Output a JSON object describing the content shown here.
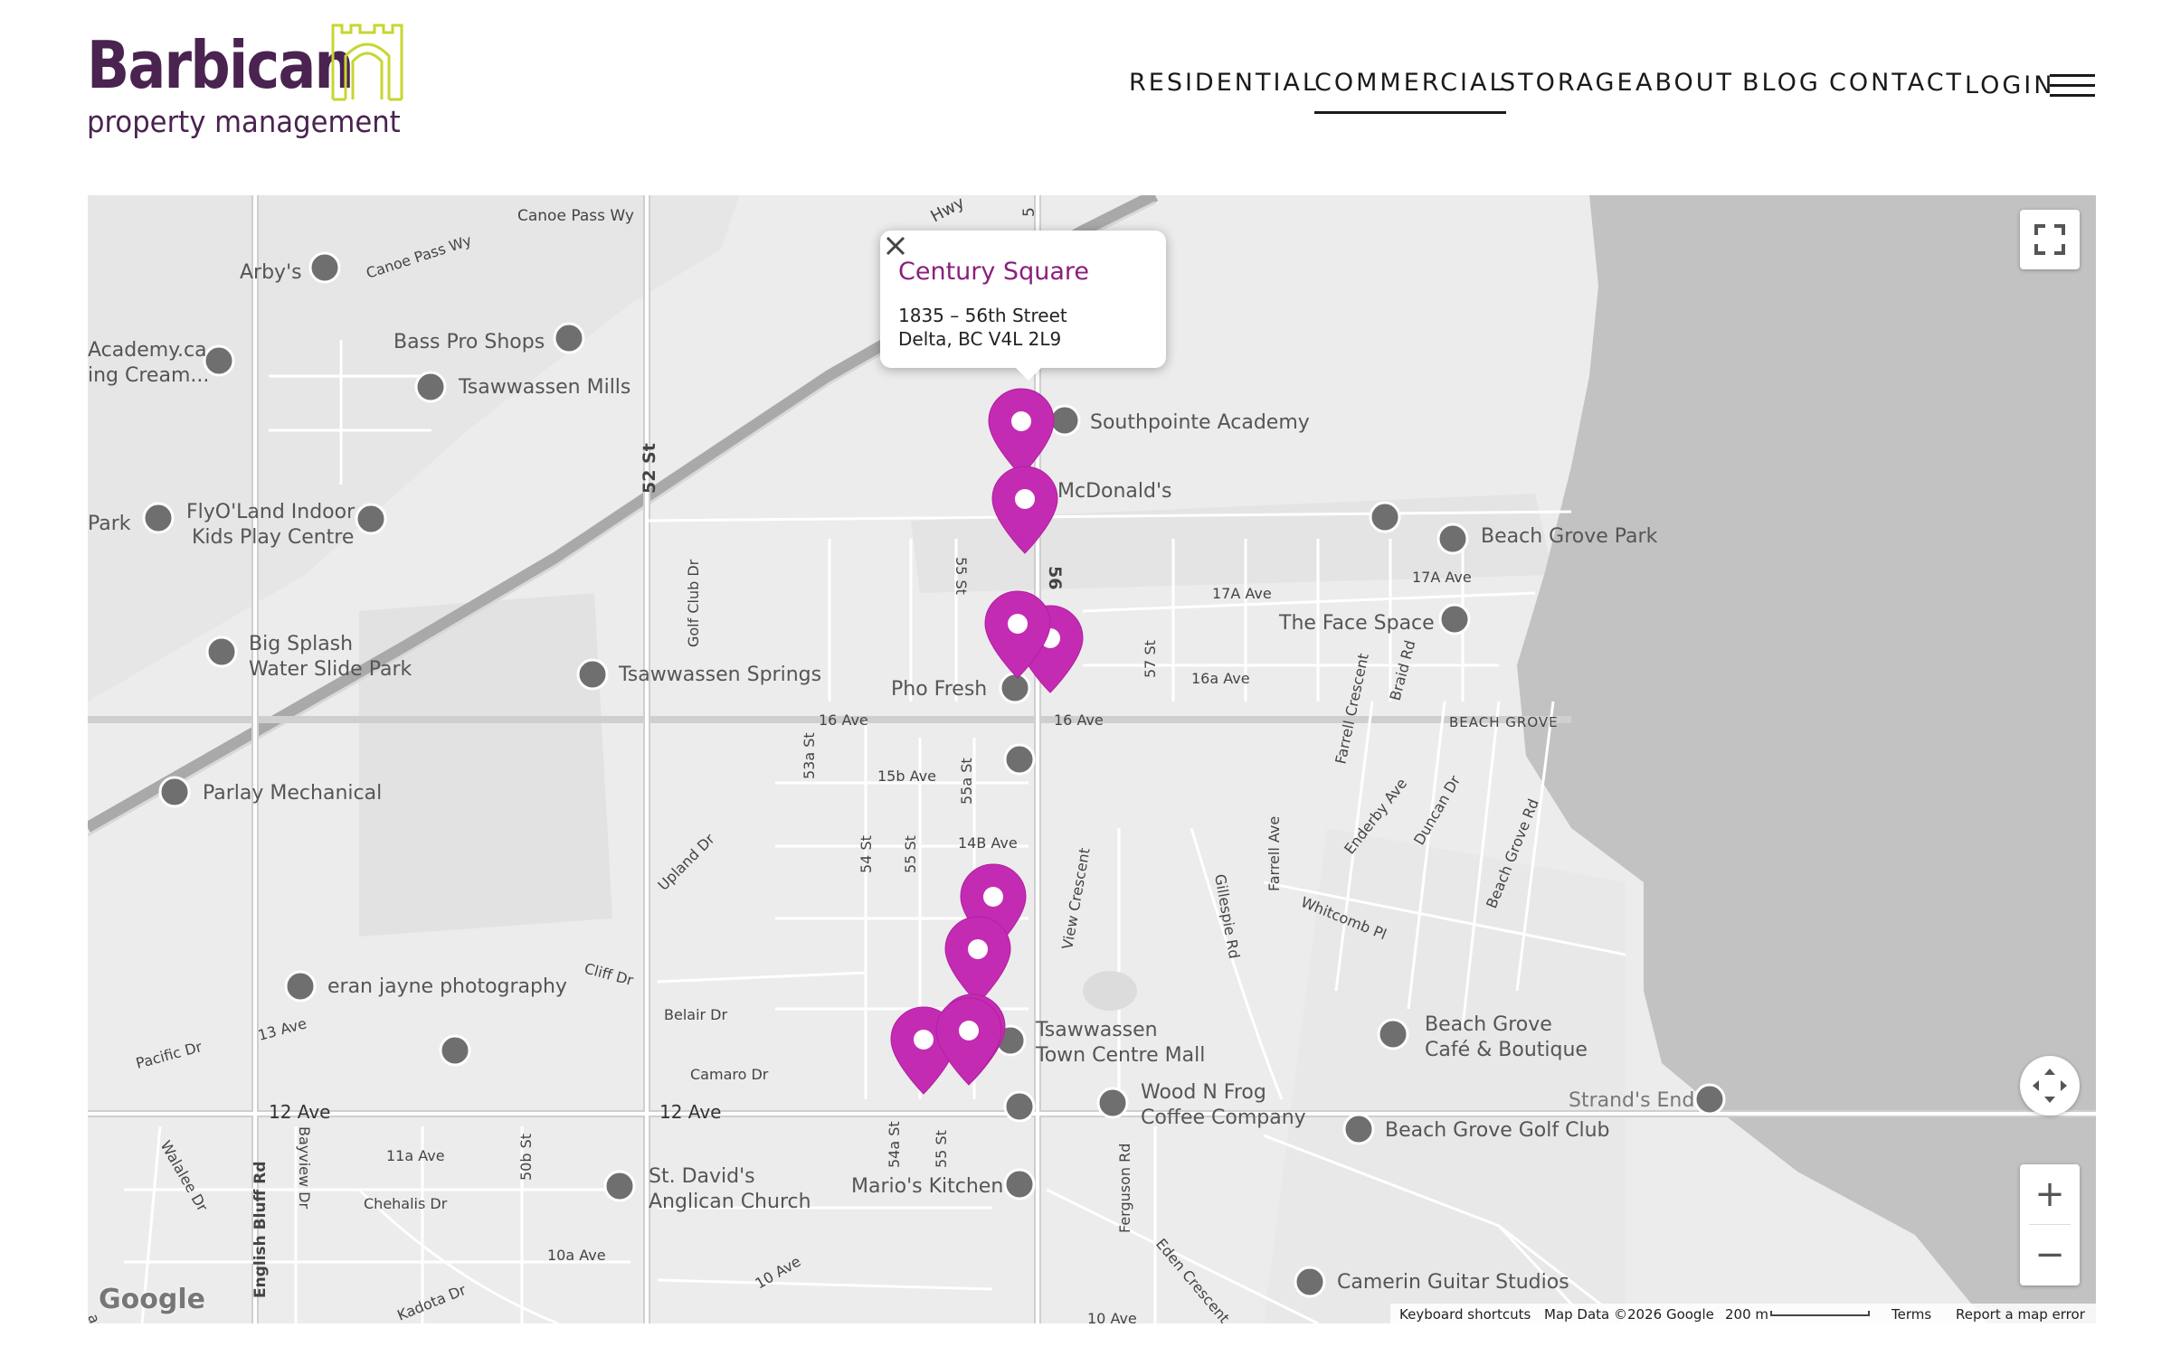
{
  "logo": {
    "word": "Barbican",
    "sub": "property management"
  },
  "nav": {
    "items": [
      "RESIDENTIAL",
      "COMMERCIAL",
      "STORAGE",
      "ABOUT",
      "BLOG",
      "CONTACT",
      "LOGIN"
    ],
    "active": "COMMERCIAL"
  },
  "popup": {
    "title": "Century Square",
    "line1": "1835 – 56th Street",
    "line2": "Delta, BC V4L 2L9"
  },
  "map_labels": {
    "canoe_pass": "Canoe Pass Wy",
    "arbys": "Arby's",
    "canoe_pass2": "Canoe Pass Wy",
    "bass_pro": "Bass Pro Shops",
    "academy1": "Academy.ca",
    "academy2": "ing Cream...",
    "tsawwassen_mills": "Tsawwassen Mills",
    "hwy": "Hwy",
    "fifty6_top": "5",
    "southpointe": "Southpointe Academy",
    "mcdonalds": "McDonald's",
    "beach_grove_park": "Beach Grove Park",
    "flyoland1": "FlyO'Land Indoor",
    "flyoland2": "Kids Play Centre",
    "park": "Park",
    "st52a": "52 St",
    "st52b": "52 St",
    "st52c": "52 St",
    "golf_club_dr": "Golf Club Dr",
    "st55": "55 St",
    "st56": "56",
    "ave17a_1": "17A Ave",
    "ave17a_2": "17A Ave",
    "face_space": "The Face Space",
    "big_splash1": "Big Splash",
    "big_splash2": "Water Slide Park",
    "tsaw_springs": "Tsawwassen Springs",
    "pho_fresh": "Pho Fresh",
    "ave16_a": "16 Ave",
    "ave16_b": "16 Ave",
    "ave16a": "16a Ave",
    "st57": "57 St",
    "beach_grove": "BEACH GROVE",
    "farrell_cres": "Farrell Crescent",
    "braid_rd": "Braid Rd",
    "parlay": "Parlay Mechanical",
    "ave15b": "15b Ave",
    "st53a": "53a St",
    "st55a": "55a St",
    "ave14b": "14B Ave",
    "st54": "54 St",
    "st55b": "55 St",
    "upland_dr": "Upland Dr",
    "view_cres": "View Crescent",
    "gillespie": "Gillespie Rd",
    "farrell_ave": "Farrell Ave",
    "enderby": "Enderby Ave",
    "duncan": "Duncan Dr",
    "beach_grove_rd": "Beach Grove Rd",
    "whitcomb": "Whitcomb Pl",
    "eran": "eran jayne photography",
    "cliff_dr": "Cliff Dr",
    "pacific_dr": "Pacific Dr",
    "ave13": "13 Ave",
    "belair": "Belair Dr",
    "camaro": "Camaro Dr",
    "tsaw_mall1": "Tsawwassen",
    "tsaw_mall2": "Town Centre Mall",
    "beach_grove_cafe1": "Beach Grove",
    "beach_grove_cafe2": "Café & Boutique",
    "strands_end": "Strand's End",
    "wood_n_frog1": "Wood N Frog",
    "wood_n_frog2": "Coffee Company",
    "beach_grove_golf": "Beach Grove Golf Club",
    "ave12_a": "12 Ave",
    "ave12_b": "12 Ave",
    "walalee": "Walalee Dr",
    "english_bluff": "English Bluff Rd",
    "bayview": "Bayview Dr",
    "ave11a": "11a Ave",
    "st50b": "50b St",
    "st_davids1": "St. David's",
    "st_davids2": "Anglican Church",
    "st54a": "54a St",
    "st55c": "55 St",
    "marios": "Mario's Kitchen",
    "ferguson": "Ferguson Rd",
    "chehalis": "Chehalis Dr",
    "ave10a": "10a Ave",
    "ave10": "10 Ave",
    "eden_cres": "Eden Crescent",
    "camerin": "Camerin Guitar Studios",
    "kodota": "Kadota Dr",
    "ana": "ana Dr",
    "ave10_b": "10 Ave"
  },
  "attribution": {
    "keyboard": "Keyboard shortcuts",
    "map_data": "Map Data ©2026 Google",
    "scale": "200 m",
    "terms": "Terms",
    "report": "Report a map error",
    "google": "Google"
  },
  "controls": {
    "zoom_in": "+",
    "zoom_out": "−"
  },
  "colors": {
    "brand": "#4a2350",
    "accent": "#c7d62f",
    "pin": "#c42bb3",
    "popup_title": "#8a1f7d",
    "water": "#bdbdbd"
  }
}
